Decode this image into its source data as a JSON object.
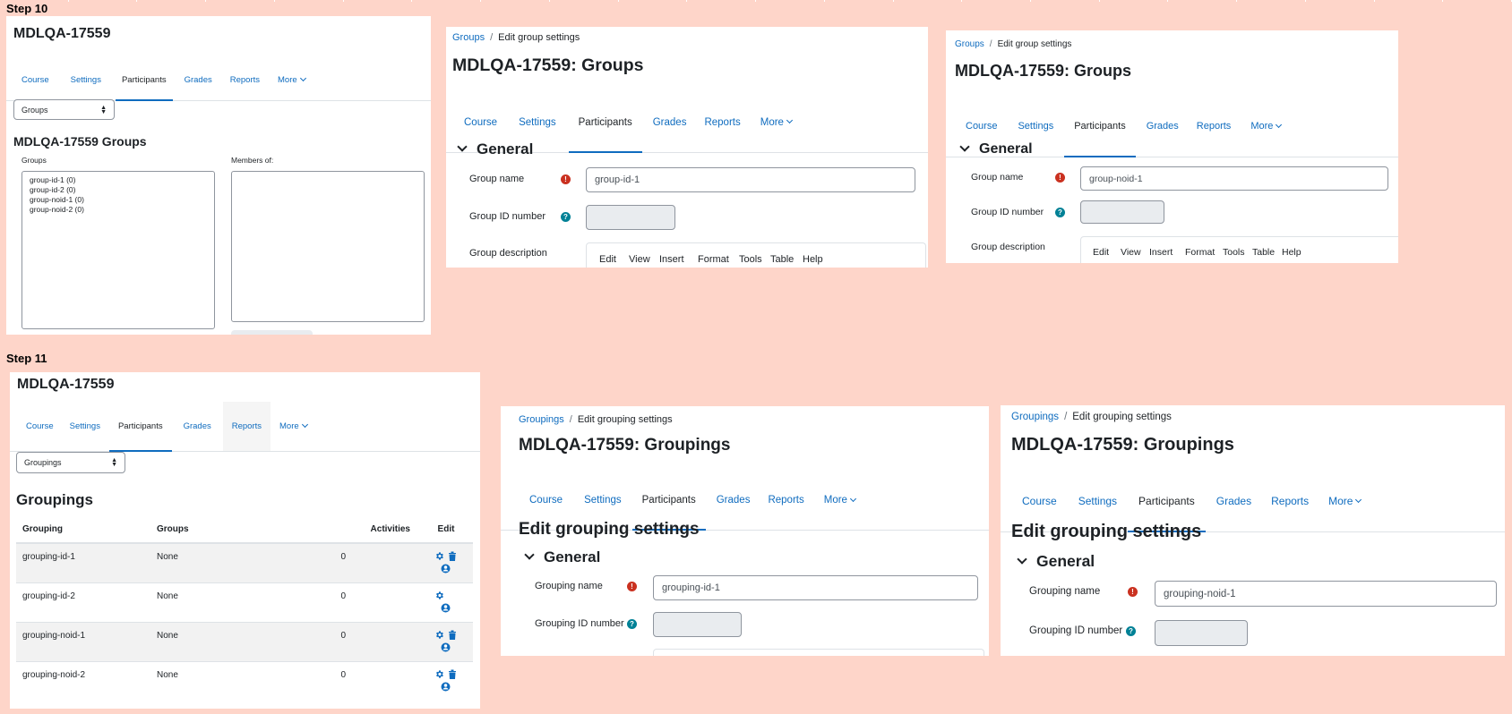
{
  "step10": {
    "label": "Step 10",
    "screen1": {
      "title": "MDLQA-17559",
      "tabs": [
        "Course",
        "Settings",
        "Participants",
        "Grades",
        "Reports",
        "More"
      ],
      "select_value": "Groups",
      "heading": "MDLQA-17559 Groups",
      "groups_label": "Groups",
      "members_label": "Members of:",
      "groups_list": [
        "group-id-1 (0)",
        "group-id-2 (0)",
        "group-noid-1 (0)",
        "group-noid-2 (0)"
      ]
    },
    "screen2": {
      "crumb_link": "Groups",
      "crumb_current": "Edit group settings",
      "title": "MDLQA-17559: Groups",
      "tabs": [
        "Course",
        "Settings",
        "Participants",
        "Grades",
        "Reports",
        "More"
      ],
      "section": "General",
      "name_label": "Group name",
      "name_value": "group-id-1",
      "idnumber_label": "Group ID number",
      "desc_label": "Group description",
      "editor_menu": [
        "Edit",
        "View",
        "Insert",
        "Format",
        "Tools",
        "Table",
        "Help"
      ]
    },
    "screen3": {
      "crumb_link": "Groups",
      "crumb_current": "Edit group settings",
      "title": "MDLQA-17559: Groups",
      "tabs": [
        "Course",
        "Settings",
        "Participants",
        "Grades",
        "Reports",
        "More"
      ],
      "section": "General",
      "name_label": "Group name",
      "name_value": "group-noid-1",
      "idnumber_label": "Group ID number",
      "desc_label": "Group description",
      "editor_menu": [
        "Edit",
        "View",
        "Insert",
        "Format",
        "Tools",
        "Table",
        "Help"
      ]
    }
  },
  "step11": {
    "label": "Step 11",
    "screen1": {
      "title": "MDLQA-17559",
      "tabs": [
        "Course",
        "Settings",
        "Participants",
        "Grades",
        "Reports",
        "More"
      ],
      "select_value": "Groupings",
      "heading": "Groupings",
      "columns": [
        "Grouping",
        "Groups",
        "Activities",
        "Edit"
      ],
      "rows": [
        {
          "grouping": "grouping-id-1",
          "groups": "None",
          "activities": "0"
        },
        {
          "grouping": "grouping-id-2",
          "groups": "None",
          "activities": "0"
        },
        {
          "grouping": "grouping-noid-1",
          "groups": "None",
          "activities": "0"
        },
        {
          "grouping": "grouping-noid-2",
          "groups": "None",
          "activities": "0"
        }
      ]
    },
    "screen2": {
      "crumb_link": "Groupings",
      "crumb_current": "Edit grouping settings",
      "title": "MDLQA-17559: Groupings",
      "tabs": [
        "Course",
        "Settings",
        "Participants",
        "Grades",
        "Reports",
        "More"
      ],
      "page_heading": "Edit grouping settings",
      "section": "General",
      "name_label": "Grouping name",
      "name_value": "grouping-id-1",
      "idnumber_label": "Grouping ID number"
    },
    "screen3": {
      "crumb_link": "Groupings",
      "crumb_current": "Edit grouping settings",
      "title": "MDLQA-17559: Groupings",
      "tabs": [
        "Course",
        "Settings",
        "Participants",
        "Grades",
        "Reports",
        "More"
      ],
      "page_heading": "Edit grouping settings",
      "section": "General",
      "name_label": "Grouping name",
      "name_value": "grouping-noid-1",
      "idnumber_label": "Grouping ID number"
    }
  },
  "colors": {
    "background": "#fed5c9",
    "link": "#0f6cbf",
    "required": "#ca3120",
    "help": "#008196"
  }
}
